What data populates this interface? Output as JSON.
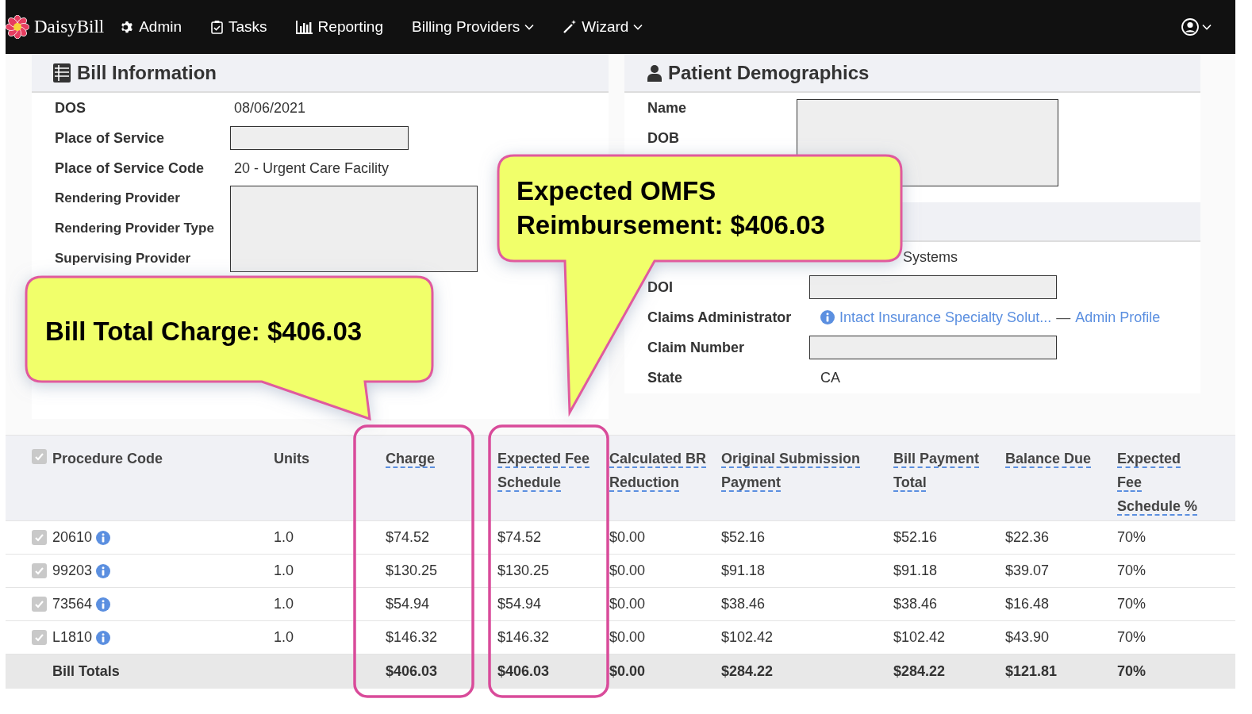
{
  "nav": {
    "logo": "DaisyBill",
    "items": [
      {
        "label": "Admin",
        "dropdown": false
      },
      {
        "label": "Tasks",
        "dropdown": false
      },
      {
        "label": "Reporting",
        "dropdown": false
      },
      {
        "label": "Billing Providers",
        "dropdown": true
      },
      {
        "label": "Wizard",
        "dropdown": true
      }
    ]
  },
  "bill_information": {
    "title": "Bill Information",
    "rows": [
      {
        "label": "DOS",
        "kind": "text",
        "value": "08/06/2021"
      },
      {
        "label": "Place of Service",
        "kind": "field"
      },
      {
        "label": "Place of Service Code",
        "kind": "text",
        "value": "20 - Urgent Care Facility"
      }
    ],
    "provider_rows": [
      "Rendering Provider",
      "Rendering Provider Type",
      "Supervising Provider"
    ]
  },
  "patient_demographics": {
    "title": "Patient Demographics",
    "boxed_rows": [
      "Name",
      "DOB"
    ],
    "rows": [
      {
        "kind": "text",
        "value": "Systems"
      },
      {
        "label": "DOI",
        "kind": "field"
      },
      {
        "label": "Claims Administrator",
        "kind": "link",
        "value": "Intact Insurance Specialty Solut...",
        "separator": "—",
        "link2": "Admin Profile"
      },
      {
        "label": "Claim Number",
        "kind": "field"
      },
      {
        "label": "State",
        "kind": "text",
        "value": "CA"
      }
    ]
  },
  "table": {
    "select_all_checked": true,
    "columns": [
      {
        "label": "Procedure Code",
        "underlined": false
      },
      {
        "label": "Units",
        "underlined": false
      },
      {
        "label": "Charge",
        "underlined": true
      },
      {
        "label": "Expected Fee Schedule",
        "underlined": true
      },
      {
        "label": "Calculated BR Reduction",
        "underlined": true
      },
      {
        "label": "Original Submission Payment",
        "underlined": true
      },
      {
        "label": "Bill Payment Total",
        "underlined": true
      },
      {
        "label": "Balance Due",
        "underlined": true
      },
      {
        "label": "Expected Fee Schedule %",
        "underlined": true
      }
    ],
    "rows": [
      {
        "checked": true,
        "cells": [
          "20610",
          "1.0",
          "$74.52",
          "$74.52",
          "$0.00",
          "$52.16",
          "$52.16",
          "$22.36",
          "70%"
        ]
      },
      {
        "checked": true,
        "cells": [
          "99203",
          "1.0",
          "$130.25",
          "$130.25",
          "$0.00",
          "$91.18",
          "$91.18",
          "$39.07",
          "70%"
        ]
      },
      {
        "checked": true,
        "cells": [
          "73564",
          "1.0",
          "$54.94",
          "$54.94",
          "$0.00",
          "$38.46",
          "$38.46",
          "$16.48",
          "70%"
        ]
      },
      {
        "checked": true,
        "cells": [
          "L1810",
          "1.0",
          "$146.32",
          "$146.32",
          "$0.00",
          "$102.42",
          "$102.42",
          "$43.90",
          "70%"
        ]
      }
    ],
    "totals": {
      "cells": [
        "Bill Totals",
        "",
        "$406.03",
        "$406.03",
        "$0.00",
        "$284.22",
        "$284.22",
        "$121.81",
        "70%"
      ]
    }
  },
  "callouts": [
    {
      "text": "Bill Total Charge: $406.03"
    },
    {
      "text": "Expected OMFS Reimbursement: $406.03"
    }
  ]
}
